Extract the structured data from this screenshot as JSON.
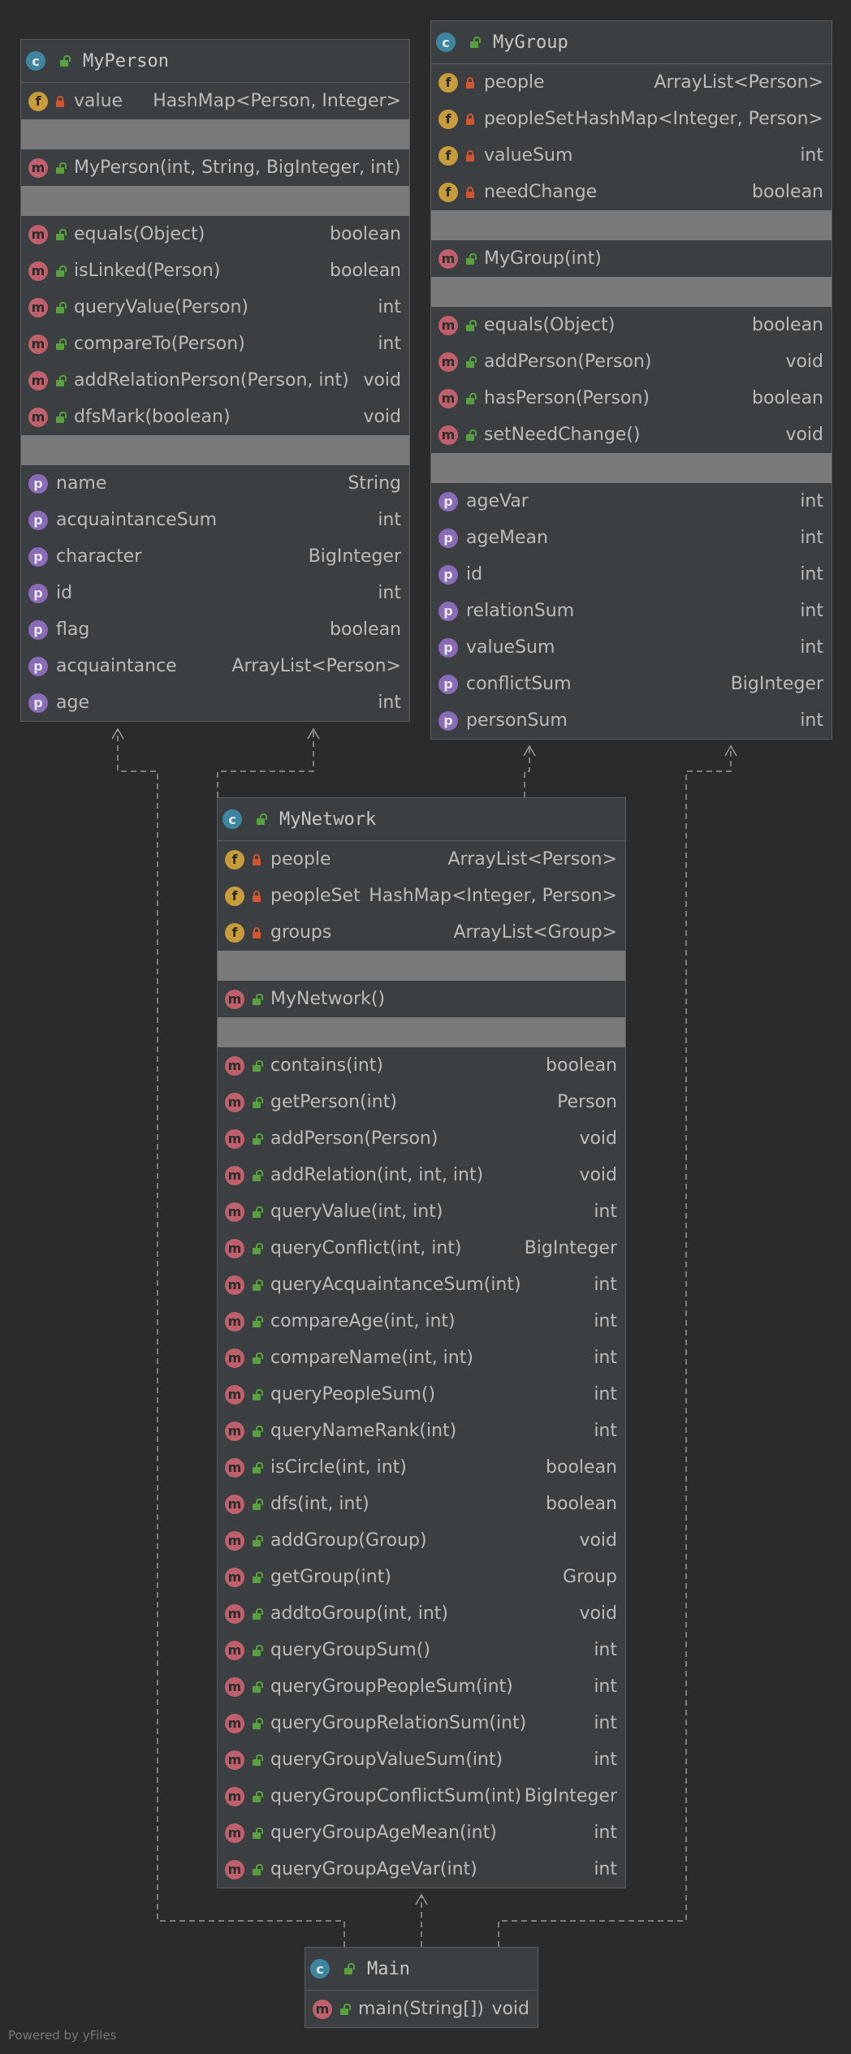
{
  "footer": "Powered by yFiles",
  "classes": {
    "myperson": {
      "name": "MyPerson",
      "fields": [
        {
          "name": "value",
          "type": "HashMap<Person, Integer>",
          "vis": "priv"
        }
      ],
      "constructors": [
        {
          "name": "MyPerson(int, String, BigInteger, int)",
          "type": ""
        }
      ],
      "methods": [
        {
          "name": "equals(Object)",
          "type": "boolean"
        },
        {
          "name": "isLinked(Person)",
          "type": "boolean"
        },
        {
          "name": "queryValue(Person)",
          "type": "int"
        },
        {
          "name": "compareTo(Person)",
          "type": "int"
        },
        {
          "name": "addRelationPerson(Person, int)",
          "type": "void"
        },
        {
          "name": "dfsMark(boolean)",
          "type": "void"
        }
      ],
      "properties": [
        {
          "name": "name",
          "type": "String"
        },
        {
          "name": "acquaintanceSum",
          "type": "int"
        },
        {
          "name": "character",
          "type": "BigInteger"
        },
        {
          "name": "id",
          "type": "int"
        },
        {
          "name": "flag",
          "type": "boolean"
        },
        {
          "name": "acquaintance",
          "type": "ArrayList<Person>"
        },
        {
          "name": "age",
          "type": "int"
        }
      ]
    },
    "mygroup": {
      "name": "MyGroup",
      "fields": [
        {
          "name": "people",
          "type": "ArrayList<Person>",
          "vis": "priv"
        },
        {
          "name": "peopleSet",
          "type": "HashMap<Integer, Person>",
          "vis": "priv"
        },
        {
          "name": "valueSum",
          "type": "int",
          "vis": "priv"
        },
        {
          "name": "needChange",
          "type": "boolean",
          "vis": "priv"
        }
      ],
      "constructors": [
        {
          "name": "MyGroup(int)",
          "type": ""
        }
      ],
      "methods": [
        {
          "name": "equals(Object)",
          "type": "boolean"
        },
        {
          "name": "addPerson(Person)",
          "type": "void"
        },
        {
          "name": "hasPerson(Person)",
          "type": "boolean"
        },
        {
          "name": "setNeedChange()",
          "type": "void"
        }
      ],
      "properties": [
        {
          "name": "ageVar",
          "type": "int"
        },
        {
          "name": "ageMean",
          "type": "int"
        },
        {
          "name": "id",
          "type": "int"
        },
        {
          "name": "relationSum",
          "type": "int"
        },
        {
          "name": "valueSum",
          "type": "int"
        },
        {
          "name": "conflictSum",
          "type": "BigInteger"
        },
        {
          "name": "personSum",
          "type": "int"
        }
      ]
    },
    "mynetwork": {
      "name": "MyNetwork",
      "fields": [
        {
          "name": "people",
          "type": "ArrayList<Person>",
          "vis": "priv"
        },
        {
          "name": "peopleSet",
          "type": "HashMap<Integer, Person>",
          "vis": "priv"
        },
        {
          "name": "groups",
          "type": "ArrayList<Group>",
          "vis": "priv"
        }
      ],
      "constructors": [
        {
          "name": "MyNetwork()",
          "type": ""
        }
      ],
      "methods": [
        {
          "name": "contains(int)",
          "type": "boolean"
        },
        {
          "name": "getPerson(int)",
          "type": "Person"
        },
        {
          "name": "addPerson(Person)",
          "type": "void"
        },
        {
          "name": "addRelation(int, int, int)",
          "type": "void"
        },
        {
          "name": "queryValue(int, int)",
          "type": "int"
        },
        {
          "name": "queryConflict(int, int)",
          "type": "BigInteger"
        },
        {
          "name": "queryAcquaintanceSum(int)",
          "type": "int"
        },
        {
          "name": "compareAge(int, int)",
          "type": "int"
        },
        {
          "name": "compareName(int, int)",
          "type": "int"
        },
        {
          "name": "queryPeopleSum()",
          "type": "int"
        },
        {
          "name": "queryNameRank(int)",
          "type": "int"
        },
        {
          "name": "isCircle(int, int)",
          "type": "boolean"
        },
        {
          "name": "dfs(int, int)",
          "type": "boolean"
        },
        {
          "name": "addGroup(Group)",
          "type": "void"
        },
        {
          "name": "getGroup(int)",
          "type": "Group"
        },
        {
          "name": "addtoGroup(int, int)",
          "type": "void"
        },
        {
          "name": "queryGroupSum()",
          "type": "int"
        },
        {
          "name": "queryGroupPeopleSum(int)",
          "type": "int"
        },
        {
          "name": "queryGroupRelationSum(int)",
          "type": "int"
        },
        {
          "name": "queryGroupValueSum(int)",
          "type": "int"
        },
        {
          "name": "queryGroupConflictSum(int)",
          "type": "BigInteger"
        },
        {
          "name": "queryGroupAgeMean(int)",
          "type": "int"
        },
        {
          "name": "queryGroupAgeVar(int)",
          "type": "int"
        }
      ],
      "properties": []
    },
    "main": {
      "name": "Main",
      "fields": [],
      "constructors": [],
      "methods": [
        {
          "name": "main(String[])",
          "type": "void"
        }
      ],
      "properties": []
    }
  },
  "colors": {
    "background": "#2b2b2b",
    "panel": "#3c3f41",
    "separator": "#7a7a7a",
    "edge": "#9a9a9a"
  }
}
